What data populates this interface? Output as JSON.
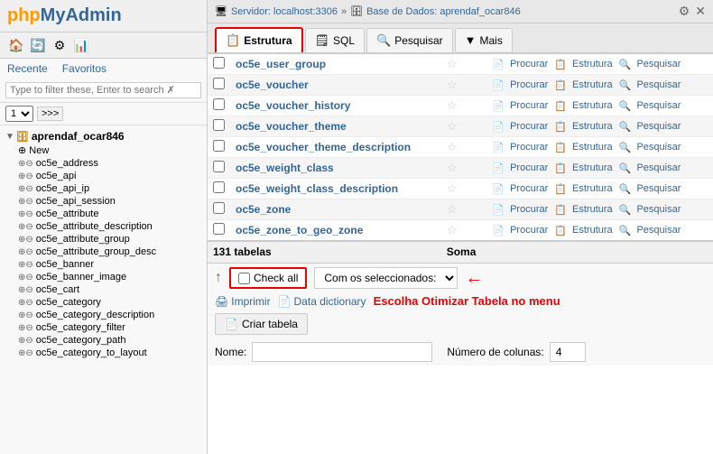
{
  "logo": {
    "php": "php",
    "myadmin": "MyAdmin"
  },
  "sidebar": {
    "icons": [
      "🏠",
      "🔄",
      "⚙",
      "📊"
    ],
    "links": [
      "Recente",
      "Favoritos"
    ],
    "filter_placeholder": "Type to filter these, Enter to search ✗",
    "pagination": {
      "current": "1",
      "next": ">>>"
    },
    "db_root": "aprendaf_ocar846",
    "items": [
      {
        "label": "New",
        "indent": 1
      },
      {
        "label": "oc5e_address",
        "indent": 2
      },
      {
        "label": "oc5e_api",
        "indent": 2
      },
      {
        "label": "oc5e_api_ip",
        "indent": 2
      },
      {
        "label": "oc5e_api_session",
        "indent": 2
      },
      {
        "label": "oc5e_attribute",
        "indent": 2
      },
      {
        "label": "oc5e_attribute_description",
        "indent": 2
      },
      {
        "label": "oc5e_attribute_group",
        "indent": 2
      },
      {
        "label": "oc5e_attribute_group_desc",
        "indent": 2
      },
      {
        "label": "oc5e_banner",
        "indent": 2
      },
      {
        "label": "oc5e_banner_image",
        "indent": 2
      },
      {
        "label": "oc5e_cart",
        "indent": 2
      },
      {
        "label": "oc5e_category",
        "indent": 2
      },
      {
        "label": "oc5e_category_description",
        "indent": 2
      },
      {
        "label": "oc5e_category_filter",
        "indent": 2
      },
      {
        "label": "oc5e_category_path",
        "indent": 2
      },
      {
        "label": "oc5e_category_to_layout",
        "indent": 2
      }
    ]
  },
  "topbar": {
    "server_label": "Servidor: localhost:3306",
    "db_label": "Base de Dados: aprendaf_ocar846",
    "icons": [
      "⚙",
      "✕"
    ]
  },
  "tabs": [
    {
      "label": "Estrutura",
      "icon": "📋",
      "active": true
    },
    {
      "label": "SQL",
      "icon": "🗒",
      "active": false
    },
    {
      "label": "Pesquisar",
      "icon": "🔍",
      "active": false
    },
    {
      "label": "Mais",
      "icon": "▼",
      "active": false
    }
  ],
  "table": {
    "rows": [
      {
        "name": "oc5e_user_group"
      },
      {
        "name": "oc5e_voucher"
      },
      {
        "name": "oc5e_voucher_history"
      },
      {
        "name": "oc5e_voucher_theme"
      },
      {
        "name": "oc5e_voucher_theme_description"
      },
      {
        "name": "oc5e_weight_class"
      },
      {
        "name": "oc5e_weight_class_description"
      },
      {
        "name": "oc5e_zone"
      },
      {
        "name": "oc5e_zone_to_geo_zone"
      }
    ],
    "footer": {
      "count": "131 tabelas",
      "soma": "Soma"
    },
    "actions": {
      "procurar": "Procurar",
      "estrutura": "Estrutura",
      "pesquisar": "Pesquisar"
    }
  },
  "bottom": {
    "check_all_label": "Check all",
    "with_selected_label": "Com os seleccionados:",
    "print_label": "Imprimir",
    "data_dict_label": "Data dictionary",
    "optimize_msg": "Escolha Otimizar Tabela no menu",
    "create_table_label": "Criar tabela",
    "form": {
      "nome_label": "Nome:",
      "nome_placeholder": "",
      "colunas_label": "Número de colunas:",
      "colunas_value": "4"
    }
  }
}
